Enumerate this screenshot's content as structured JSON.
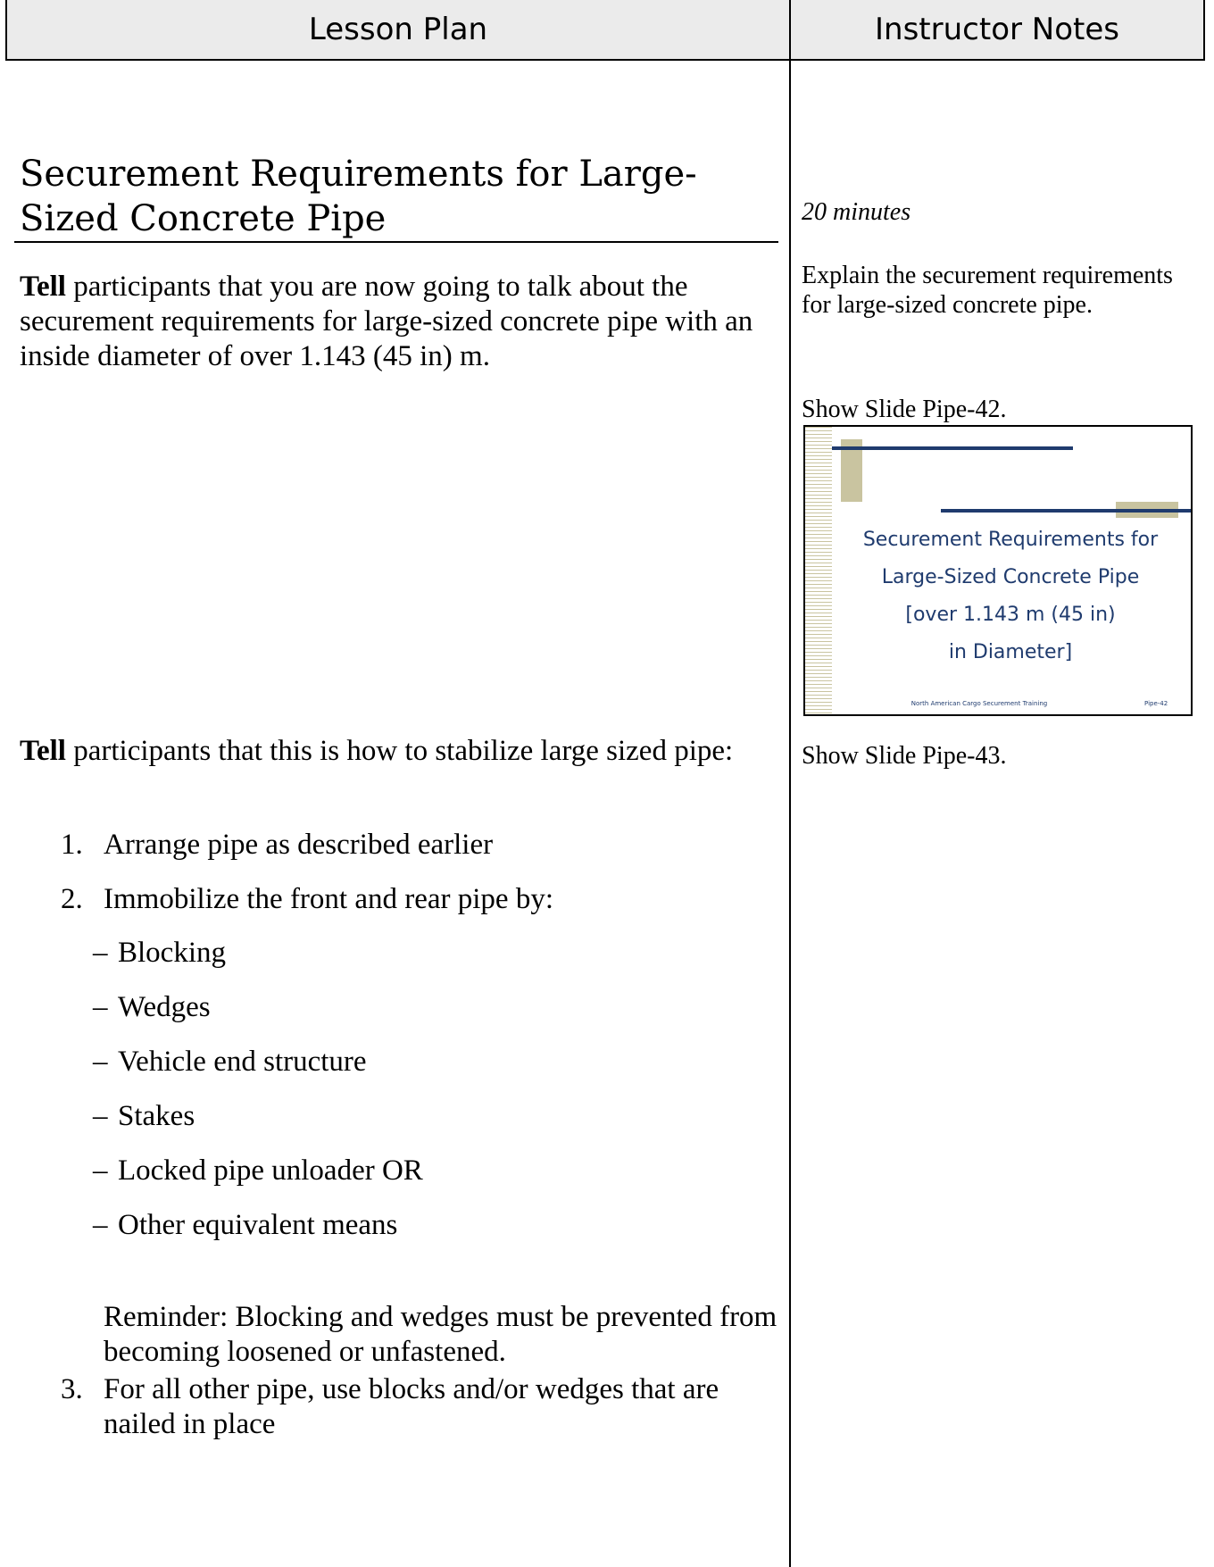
{
  "header": {
    "left": "Lesson Plan",
    "right": "Instructor Notes"
  },
  "lesson": {
    "title_line1": "Securement Requirements for Large-",
    "title_line2": "Sized Concrete Pipe",
    "p1_bold": "Tell",
    "p1_text": " participants that you are now going to talk about the securement requirements for large-sized concrete pipe with an inside diameter of over 1.143 (45 in) m.",
    "p2_bold": "Tell",
    "p2_text": " participants that this is how to stabilize large sized pipe:",
    "steps": [
      {
        "num": "1.",
        "text": "Arrange pipe as described earlier"
      },
      {
        "num": "2.",
        "text": "Immobilize the front and rear pipe by:"
      },
      {
        "num": "3.",
        "text": "For all other pipe, use blocks and/or wedges that are nailed in place"
      }
    ],
    "sub_items": [
      "Blocking",
      "Wedges",
      "Vehicle end structure",
      "Stakes",
      "Locked pipe unloader  OR",
      "Other equivalent means"
    ],
    "dash": "–",
    "reminder": "Reminder: Blocking and wedges must be prevented from becoming loosened or unfastened."
  },
  "notes": {
    "duration": "20 minutes",
    "explain": "Explain the securement requirements for large-sized concrete pipe.",
    "show1": "Show Slide Pipe-42.",
    "show2": "Show Slide Pipe-43."
  },
  "slide": {
    "line1": "Securement Requirements for",
    "line2": "Large-Sized Concrete Pipe",
    "line3": "[over 1.143 m (45 in)",
    "line4": "in Diameter]",
    "footer": "North American Cargo Securement Training",
    "number": "Pipe-42"
  }
}
